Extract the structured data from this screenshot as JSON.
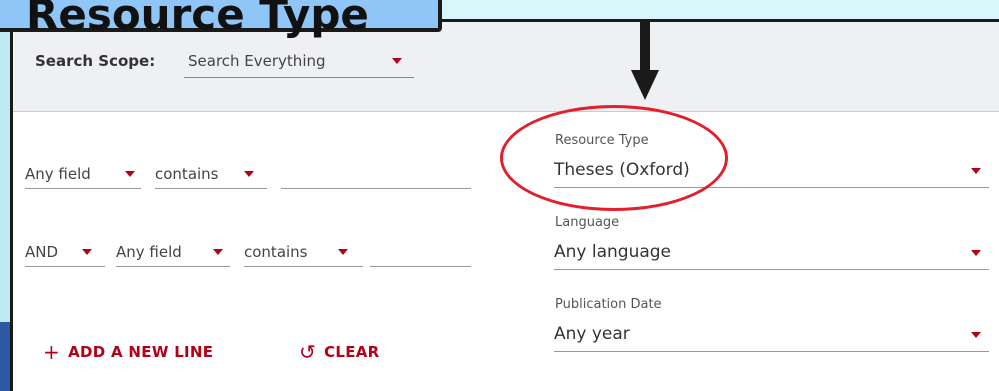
{
  "callout": {
    "text": "Resource Type"
  },
  "scope": {
    "label": "Search Scope:",
    "value": "Search Everything"
  },
  "query_rows": [
    {
      "field": "Any field",
      "operator": "contains",
      "value": ""
    },
    {
      "boolean": "AND",
      "field": "Any field",
      "operator": "contains",
      "value": ""
    }
  ],
  "facets": {
    "resource_type": {
      "label": "Resource Type",
      "value": "Theses (Oxford)"
    },
    "language": {
      "label": "Language",
      "value": "Any language"
    },
    "publication_date": {
      "label": "Publication Date",
      "value": "Any year"
    }
  },
  "actions": {
    "add_line": "ADD A NEW LINE",
    "clear": "CLEAR"
  },
  "colors": {
    "accent": "#b30019",
    "callout_bg": "#8fc6f7",
    "highlight": "#e21f2a"
  }
}
